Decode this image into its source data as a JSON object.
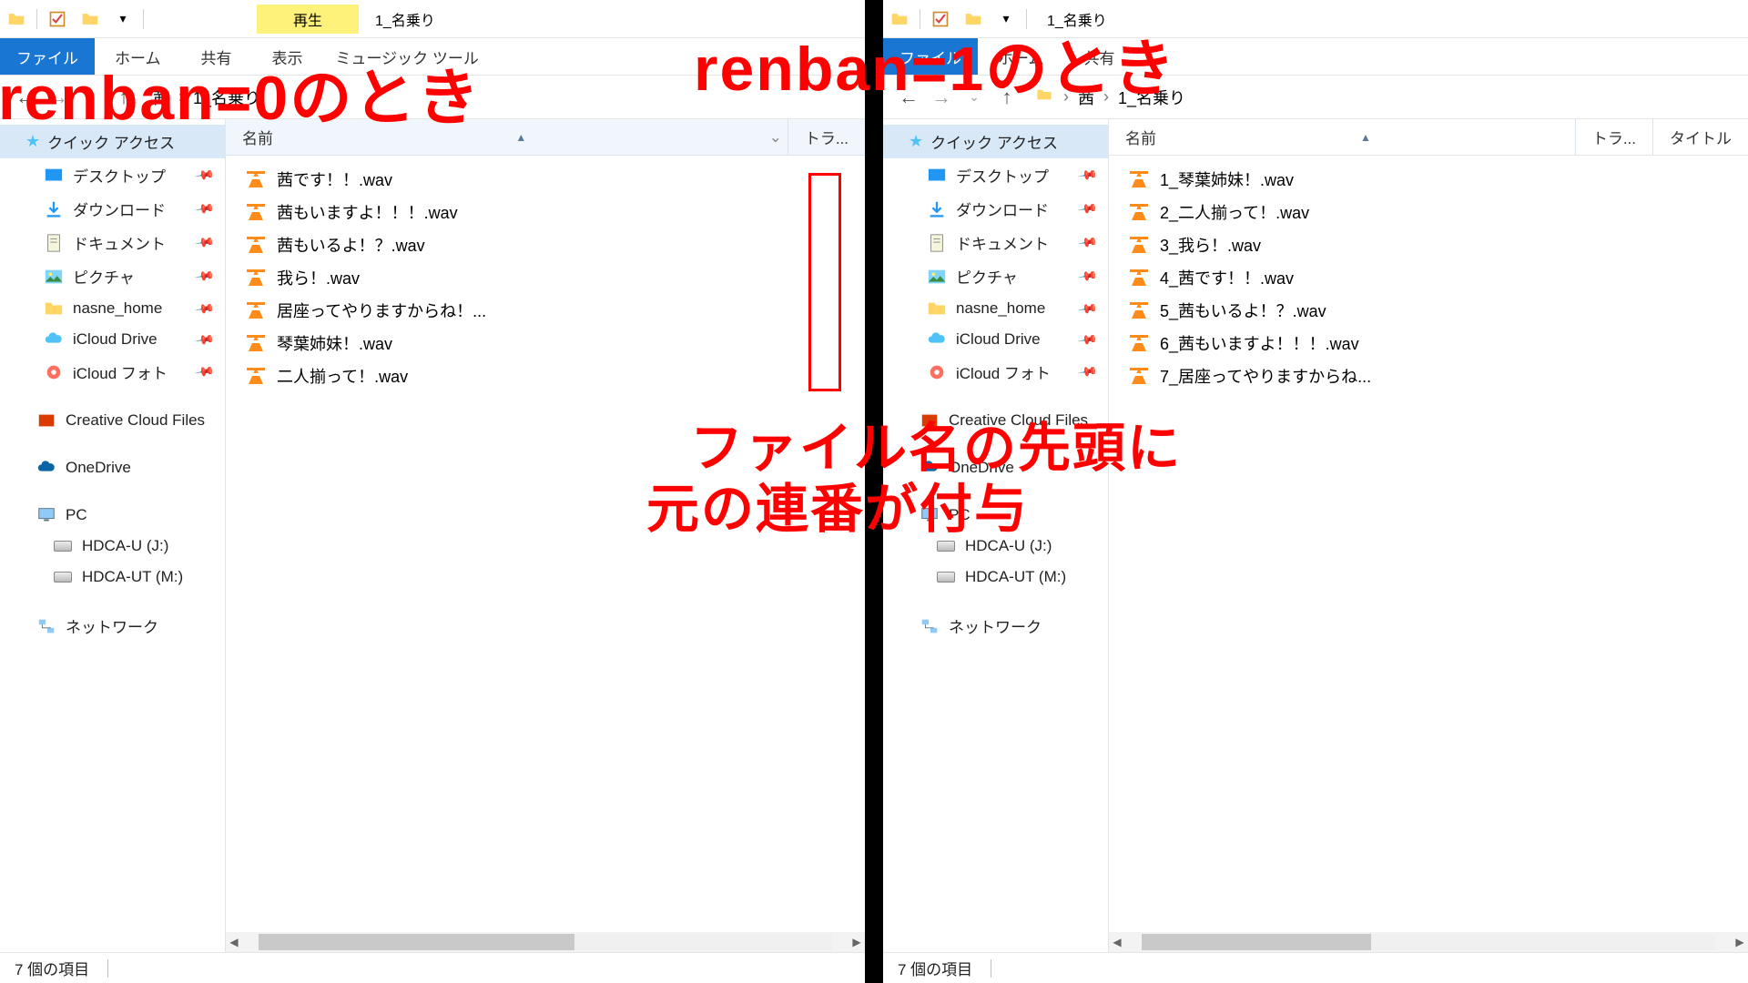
{
  "annotations": {
    "a1": "renban=0のとき",
    "a2": "renban=1のとき",
    "a3_l1": "ファイル名の先頭に",
    "a3_l2": "元の連番が付与"
  },
  "left": {
    "titlebar": {
      "play_tab": "再生",
      "window_title": "1_名乗り"
    },
    "ribbon": {
      "file": "ファイル",
      "home": "ホーム",
      "share": "共有",
      "view": "表示",
      "music_tool": "ミュージック ツール"
    },
    "breadcrumb": {
      "p1": "茜",
      "p2": "1_名乗り"
    },
    "sidebar": {
      "quick_access": "クイック アクセス",
      "items": [
        {
          "label": "デスクトップ",
          "pin": true
        },
        {
          "label": "ダウンロード",
          "pin": true
        },
        {
          "label": "ドキュメント",
          "pin": true
        },
        {
          "label": "ピクチャ",
          "pin": true
        },
        {
          "label": "nasne_home",
          "pin": true
        },
        {
          "label": "iCloud Drive",
          "pin": true
        },
        {
          "label": "iCloud フォト",
          "pin": true
        }
      ],
      "creative": "Creative Cloud Files",
      "onedrive": "OneDrive",
      "pc": "PC",
      "hd1": "HDCA-U (J:)",
      "hd2": "HDCA-UT (M:)",
      "network": "ネットワーク"
    },
    "columns": {
      "name": "名前",
      "track": "トラ..."
    },
    "files": [
      "茜です！！.wav",
      "茜もいますよ！！！.wav",
      "茜もいるよ！？.wav",
      "我ら！.wav",
      "居座ってやりますからね！...",
      "琴葉姉妹！.wav",
      "二人揃って！.wav"
    ],
    "status": "7 個の項目"
  },
  "right": {
    "titlebar": {
      "window_title": "1_名乗り"
    },
    "ribbon": {
      "file": "ファイル",
      "home": "ホーム",
      "share": "共有"
    },
    "breadcrumb": {
      "p1": "茜",
      "p2": "1_名乗り"
    },
    "sidebar": {
      "quick_access": "クイック アクセス",
      "items": [
        {
          "label": "デスクトップ",
          "pin": true
        },
        {
          "label": "ダウンロード",
          "pin": true
        },
        {
          "label": "ドキュメント",
          "pin": true
        },
        {
          "label": "ピクチャ",
          "pin": true
        },
        {
          "label": "nasne_home",
          "pin": true
        },
        {
          "label": "iCloud Drive",
          "pin": true
        },
        {
          "label": "iCloud フォト",
          "pin": true
        }
      ],
      "creative": "Creative Cloud Files",
      "onedrive": "OneDrive",
      "pc": "PC",
      "hd1": "HDCA-U (J:)",
      "hd2": "HDCA-UT (M:)",
      "network": "ネットワーク"
    },
    "columns": {
      "name": "名前",
      "track": "トラ...",
      "title": "タイトル"
    },
    "files": [
      "1_琴葉姉妹！.wav",
      "2_二人揃って！.wav",
      "3_我ら！.wav",
      "4_茜です！！.wav",
      "5_茜もいるよ！？.wav",
      "6_茜もいますよ！！！.wav",
      "7_居座ってやりますからね..."
    ],
    "status": "7 個の項目"
  }
}
